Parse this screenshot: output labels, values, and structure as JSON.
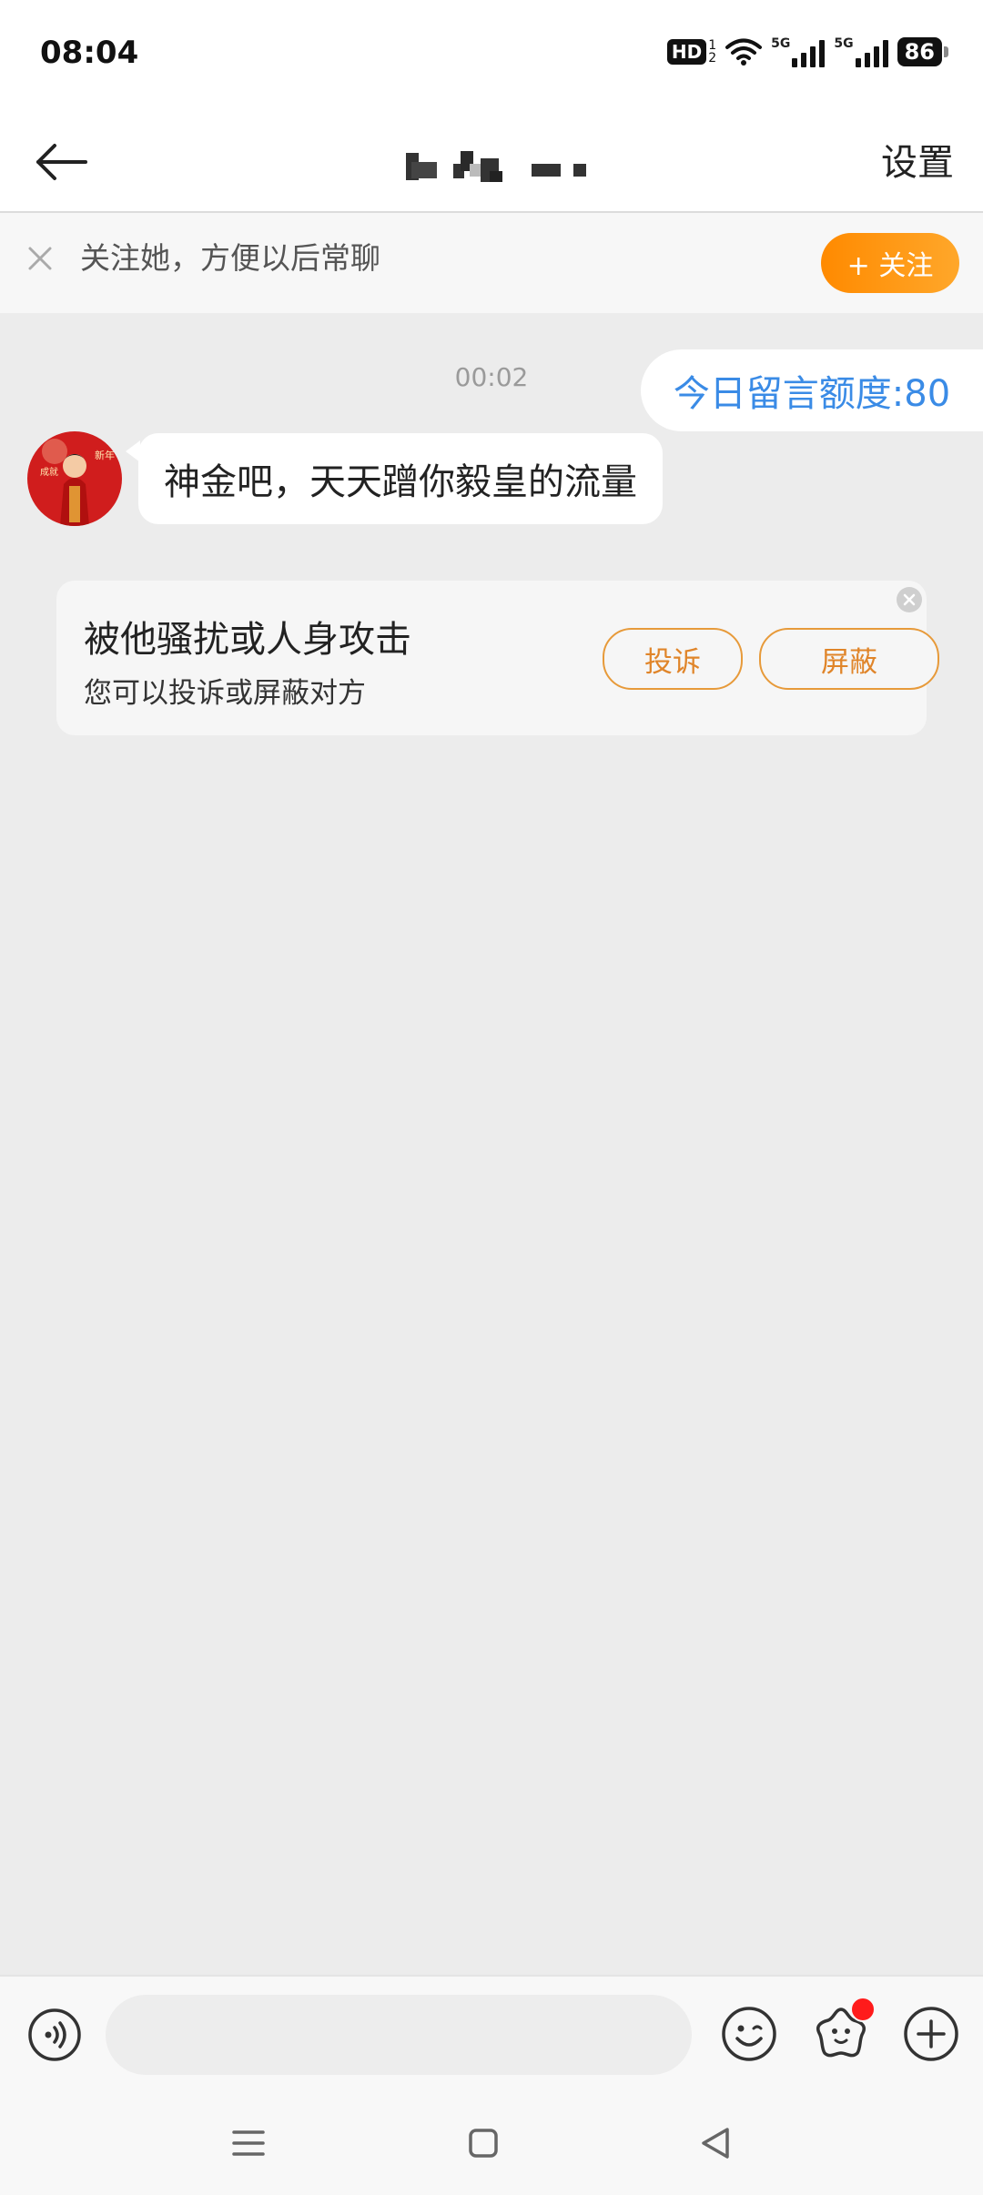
{
  "status_bar": {
    "time": "08:04",
    "hd_label": "HD",
    "hd_sub_top": "1",
    "hd_sub_bottom": "2",
    "net1": "5G",
    "net2": "5G",
    "battery": "86"
  },
  "header": {
    "back_icon": "arrow-left-icon",
    "title_obscured": true,
    "settings_label": "设置"
  },
  "follow_bar": {
    "text": "关注她，方便以后常聊",
    "button_label": "+ 关注",
    "accent_color": "#ff8f0f"
  },
  "chat": {
    "timestamp": "00:02",
    "quota_text": "今日留言额度:80",
    "messages": [
      {
        "sender": "other",
        "text": "神金吧，天天蹭你毅皇的流量"
      }
    ],
    "report_card": {
      "title": "被他骚扰或人身攻击",
      "subtitle": "您可以投诉或屏蔽对方",
      "complain_label": "投诉",
      "block_label": "屏蔽"
    }
  },
  "input_bar": {
    "placeholder": "",
    "icons": [
      "voice-icon",
      "emoji-icon",
      "sticker-icon",
      "plus-icon"
    ],
    "sticker_has_badge": true
  },
  "nav_bar": {
    "icons": [
      "menu-icon",
      "home-icon",
      "back-triangle-icon"
    ]
  }
}
